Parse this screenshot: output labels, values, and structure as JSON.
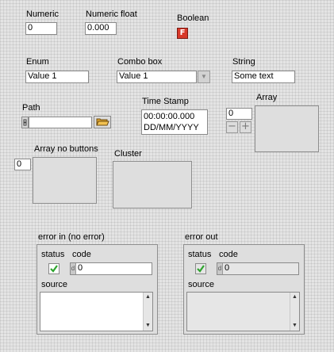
{
  "numeric": {
    "label": "Numeric",
    "value": "0"
  },
  "numeric_float": {
    "label": "Numeric float",
    "value": "0.000"
  },
  "boolean": {
    "label": "Boolean",
    "value": "F"
  },
  "enum": {
    "label": "Enum",
    "value": "Value 1"
  },
  "combo_box": {
    "label": "Combo box",
    "value": "Value 1"
  },
  "string": {
    "label": "String",
    "value": "Some text"
  },
  "path": {
    "label": "Path",
    "value": ""
  },
  "time_stamp": {
    "label": "Time Stamp",
    "time": "00:00:00.000",
    "date": "DD/MM/YYYY"
  },
  "array": {
    "label": "Array",
    "index": "0"
  },
  "array_no_buttons": {
    "label": "Array no buttons",
    "index": "0"
  },
  "cluster": {
    "label": "Cluster"
  },
  "error_in": {
    "label": "error in (no error)",
    "status_label": "status",
    "code_label": "code",
    "code_value": "0",
    "source_label": "source",
    "source_value": ""
  },
  "error_out": {
    "label": "error out",
    "status_label": "status",
    "code_label": "code",
    "code_value": "0",
    "source_label": "source",
    "source_value": ""
  },
  "icons": {
    "status_check": "check-icon",
    "folder": "folder-icon",
    "path_type": "path-type-icon"
  },
  "colors": {
    "boolean_false": "#d8392a",
    "check_green": "#2fa52f"
  }
}
